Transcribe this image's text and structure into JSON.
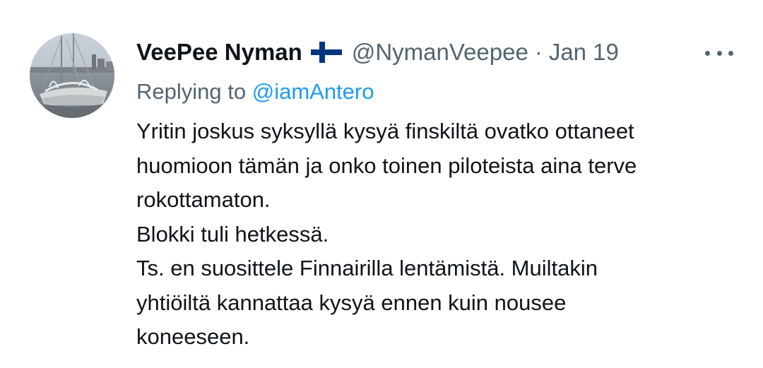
{
  "tweet": {
    "author": {
      "display_name": "VeePee Nyman",
      "flag_icon": "finland-flag-icon",
      "handle": "@NymanVeepee",
      "separator": "·",
      "date": "Jan 19",
      "avatar_icon": "avatar-frozen-sailboat-icon"
    },
    "more_icon": "more-dots-icon",
    "replying_prefix": "Replying to",
    "replying_mention": "@iamAntero",
    "lines": [
      "Yritin joskus syksyllä kysyä finskiltä ovatko ottaneet",
      "huomioon tämän ja onko toinen piloteista aina terve",
      "rokottamaton.",
      "Blokki tuli hetkessä.",
      "Ts. en suosittele Finnairilla lentämistä. Muiltakin",
      "yhtiöiltä kannattaa kysyä ennen kuin nousee",
      "koneeseen."
    ]
  },
  "colors": {
    "text_primary": "#0f1419",
    "text_secondary": "#536471",
    "link": "#1d9bf0",
    "flag_blue": "#003580",
    "background": "#ffffff"
  }
}
